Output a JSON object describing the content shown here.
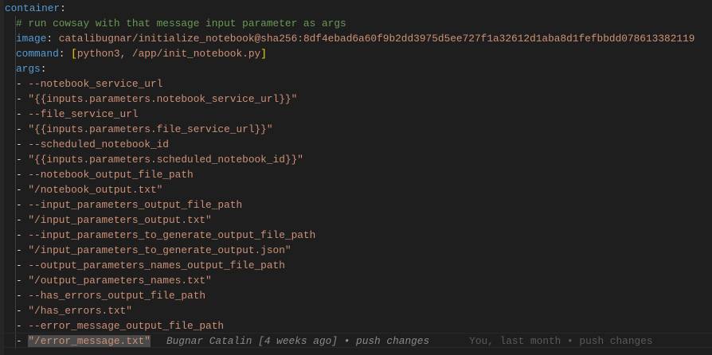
{
  "editor": {
    "root_key": "container",
    "comment": "# run cowsay with that message input parameter as args",
    "image_key": "image",
    "image_value": "catalibugnar/initialize_notebook@sha256:8df4ebad6a60f9b2dd3975d5ee727f1a32612d1aba8d1fefbbdd078613382119",
    "command_key": "command",
    "command_value": "python3, /app/init_notebook.py",
    "args_key": "args",
    "args": [
      "--notebook_service_url",
      "\"{{inputs.parameters.notebook_service_url}}\"",
      "--file_service_url",
      "\"{{inputs.parameters.file_service_url}}\"",
      "--scheduled_notebook_id",
      "\"{{inputs.parameters.scheduled_notebook_id}}\"",
      "--notebook_output_file_path",
      "\"/notebook_output.txt\"",
      "--input_parameters_output_file_path",
      "\"/input_parameters_output.txt\"",
      "--input_parameters_to_generate_output_file_path",
      "\"/input_parameters_to_generate_output.json\"",
      "--output_parameters_names_output_file_path",
      "\"/output_parameters_names.txt\"",
      "--has_errors_output_file_path",
      "\"/has_errors.txt\"",
      "--error_message_output_file_path",
      "\"/error_message.txt\""
    ],
    "blame_inline": "Bugnar Catalin [4 weeks ago] • push changes",
    "blame_status": "You, last month • push changes",
    "colors": {
      "background": "#1e1e1e",
      "key": "#569cd6",
      "string": "#ce9178",
      "comment": "#6a9955",
      "bracket": "#ffd700"
    }
  }
}
